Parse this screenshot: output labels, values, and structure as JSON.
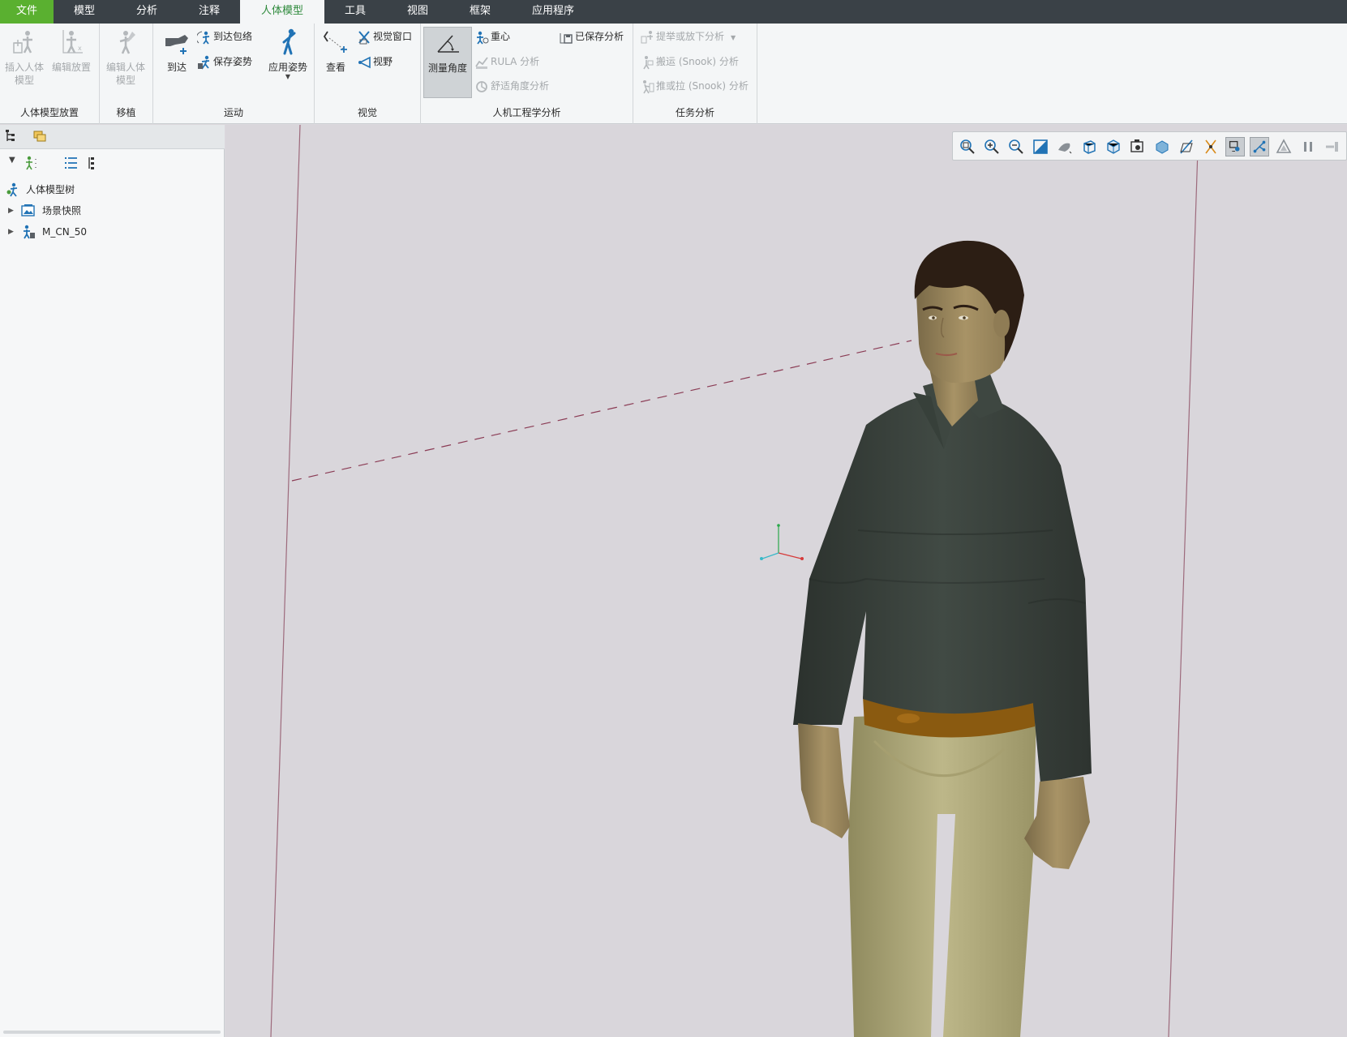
{
  "menu": {
    "tabs": [
      {
        "label": "文件"
      },
      {
        "label": "模型"
      },
      {
        "label": "分析"
      },
      {
        "label": "注释"
      },
      {
        "label": "人体模型"
      },
      {
        "label": "工具"
      },
      {
        "label": "视图"
      },
      {
        "label": "框架"
      },
      {
        "label": "应用程序"
      }
    ],
    "active_tab": "人体模型"
  },
  "ribbon": {
    "groups": {
      "placement": {
        "label": "人体模型放置",
        "insert_label": "插入人体\n模型",
        "edit_label": "编辑放置"
      },
      "transplant": {
        "label": "移植",
        "edit_model_label": "编辑人体\n模型"
      },
      "motion": {
        "label": "运动",
        "reach_label": "到达",
        "reach_envelope_label": "到达包络",
        "save_posture_label": "保存姿势",
        "apply_posture_label": "应用姿势"
      },
      "vision": {
        "label": "视觉",
        "view_label": "查看",
        "vision_window_label": "视觉窗口",
        "field_of_view_label": "视野"
      },
      "ergonomics": {
        "label": "人机工程学分析",
        "measure_angle_label": "测量角度",
        "center_gravity_label": "重心",
        "rula_label": "RULA 分析",
        "comfort_angle_label": "舒适角度分析",
        "saved_analysis_label": "已保存分析"
      },
      "task": {
        "label": "任务分析",
        "lift_lower_label": "提举或放下分析",
        "carry_label": "搬运 (Snook) 分析",
        "push_pull_label": "推或拉 (Snook) 分析"
      }
    }
  },
  "model_tree": {
    "root_label": "人体模型树",
    "items": [
      {
        "label": "场景快照"
      },
      {
        "label": "M_CN_50"
      }
    ]
  },
  "viewport": {
    "background_color": "#d9d6db",
    "toolbar_icons": [
      "refit-icon",
      "zoom-in-icon",
      "zoom-out-icon",
      "repaint-icon",
      "display-style-icon",
      "saved-orientations-icon",
      "view-manager-icon",
      "perspective-icon",
      "section-icon",
      "datum-display-icon",
      "annotation-display-icon",
      "spin-center-icon",
      "manikin-display-icon",
      "appearance-icon",
      "pause-icon",
      "next-icon"
    ]
  },
  "colors": {
    "tabbar": "#3a4147",
    "file_tab": "#5ab030",
    "active_tab_text": "#2e8a3c",
    "accent_blue": "#2173b5"
  }
}
